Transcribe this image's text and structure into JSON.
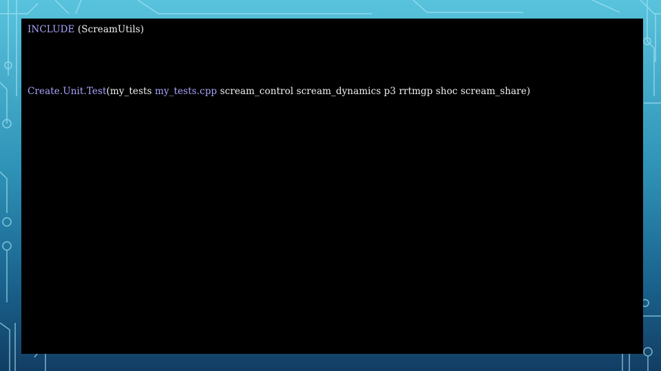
{
  "colors": {
    "keyword": "#a9a6ff",
    "text": "#f2f2f2",
    "panel_background": "#000000",
    "slide_background_top": "#59c3dd",
    "slide_background_bottom": "#123d63"
  },
  "code": {
    "line1": {
      "keyword": "INCLUDE",
      "args": " (ScreamUtils)"
    },
    "line2": {
      "function": "Create.Unit.Test",
      "open": "(my_tests ",
      "source_file": "my_tests.cpp",
      "rest": " scream_control scream_dynamics p3 rrtmgp shoc scream_share)"
    }
  }
}
